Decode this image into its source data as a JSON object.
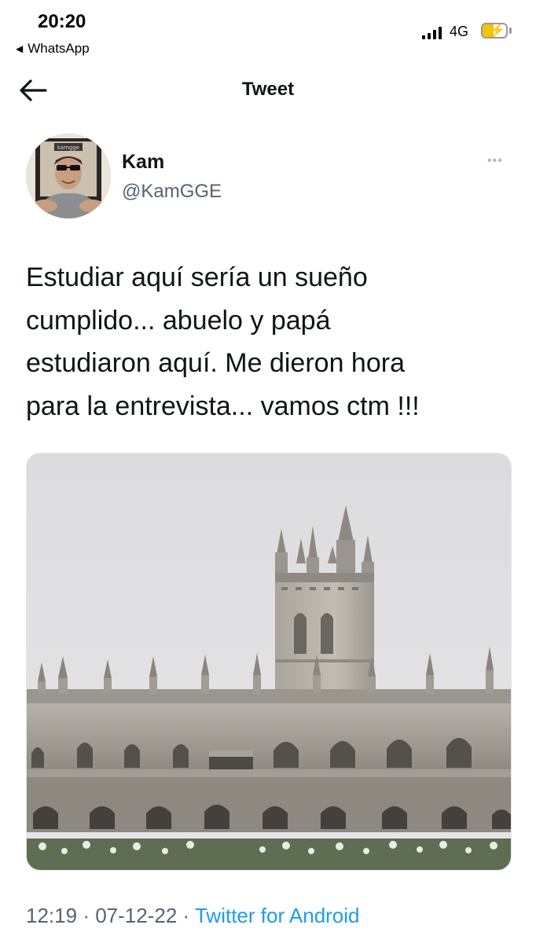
{
  "status_bar": {
    "time": "20:20",
    "back_app": "WhatsApp",
    "network": "4G",
    "battery_level": 0.45,
    "battery_color": "#f5c400"
  },
  "header": {
    "title": "Tweet",
    "back_icon": "arrow-left-icon"
  },
  "tweet": {
    "author_name": "Kam",
    "author_handle": "@KamGGE",
    "more_icon": "more-dots-icon",
    "text": "Estudiar aquí sería un sueño\ncumplido... abuelo y papá\nestudiaron aquí.  Me dieron hora\npara la entrevista... vamos ctm !!!",
    "media": "gothic-college-building-photo",
    "time": "12:19",
    "date": "07-12-22",
    "separator": "·",
    "source": "Twitter for Android",
    "link_color": "#1d9bf0"
  }
}
